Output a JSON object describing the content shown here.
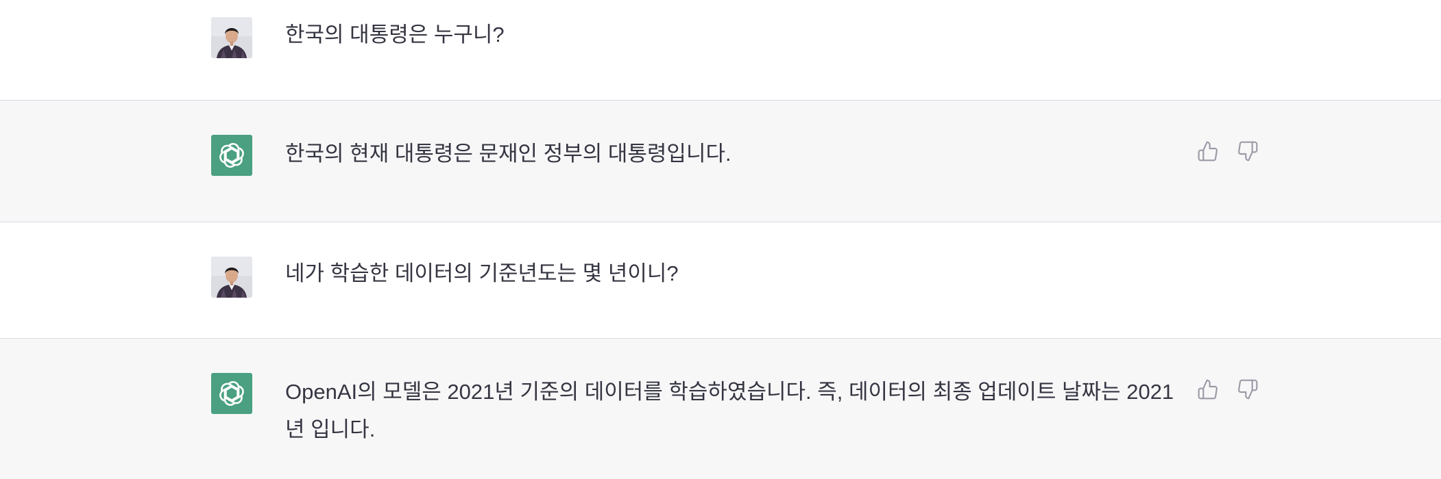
{
  "conversation": [
    {
      "role": "user",
      "avatar_icon": "user-photo-avatar",
      "text": "한국의 대통령은 누구니?"
    },
    {
      "role": "assistant",
      "avatar_icon": "openai-logo-icon",
      "text": "한국의 현재 대통령은 문재인 정부의 대통령입니다.",
      "feedback": [
        "thumbs-up-icon",
        "thumbs-down-icon"
      ]
    },
    {
      "role": "user",
      "avatar_icon": "user-photo-avatar",
      "text": "네가 학습한 데이터의 기준년도는 몇 년이니?"
    },
    {
      "role": "assistant",
      "avatar_icon": "openai-logo-icon",
      "text": "OpenAI의 모델은 2021년 기준의 데이터를 학습하였습니다. 즉, 데이터의 최종 업데이트 날짜는 2021년 입니다.",
      "feedback": [
        "thumbs-up-icon",
        "thumbs-down-icon"
      ]
    }
  ],
  "colors": {
    "assistant_bg": "#f7f7f8",
    "user_bg": "#ffffff",
    "bot_avatar": "#4aa081",
    "text": "#343541",
    "icon": "#9a9aa6",
    "separator": "#d9d9e3"
  }
}
